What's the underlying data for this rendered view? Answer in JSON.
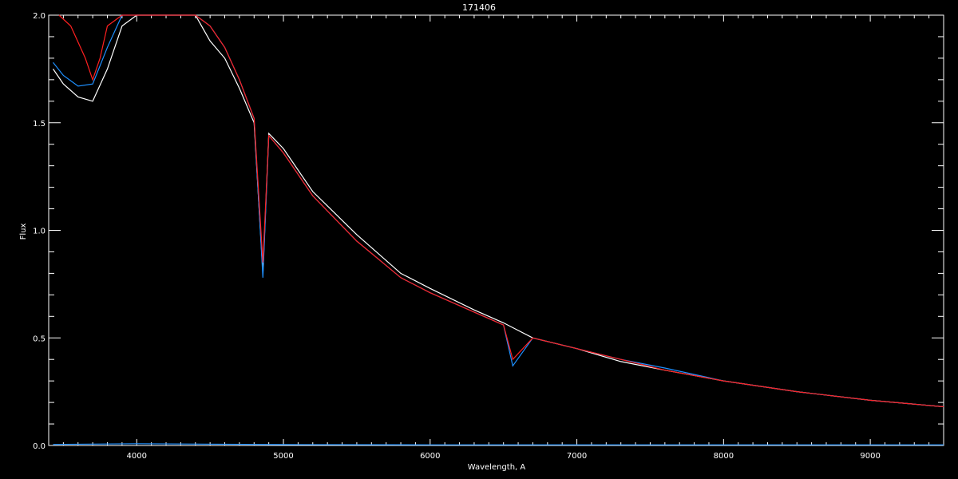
{
  "chart_data": {
    "type": "line",
    "title": "171406",
    "xlabel": "Wavelength, A",
    "ylabel": "Flux",
    "xlim": [
      3400,
      9500
    ],
    "ylim": [
      0.0,
      2.0
    ],
    "grid": false,
    "x_ticks": [
      4000,
      5000,
      6000,
      7000,
      8000,
      9000
    ],
    "x_tick_labels": [
      "4000",
      "5000",
      "6000",
      "7000",
      "8000",
      "9000"
    ],
    "y_ticks": [
      0.0,
      0.5,
      1.0,
      1.5,
      2.0
    ],
    "y_tick_labels": [
      "0.0",
      "0.5",
      "1.0",
      "1.5",
      "2.0"
    ],
    "series": [
      {
        "color": "#ffffff",
        "x": [
          3430,
          3500,
          3600,
          3700,
          3800,
          3900,
          4000,
          4200,
          4400,
          4500,
          4600,
          4700,
          4800,
          4860,
          4900,
          5000,
          5200,
          5500,
          5800,
          6000,
          6300,
          6500,
          6700,
          7000,
          7300,
          7600,
          8000,
          8500,
          9000,
          9500
        ],
        "y": [
          1.75,
          1.68,
          1.62,
          1.6,
          1.75,
          1.95,
          2.05,
          2.1,
          2.05,
          1.88,
          1.8,
          1.66,
          1.5,
          0.8,
          1.45,
          1.38,
          1.18,
          0.98,
          0.8,
          0.73,
          0.63,
          0.57,
          0.5,
          0.45,
          0.39,
          0.35,
          0.3,
          0.25,
          0.21,
          0.18
        ]
      },
      {
        "color": "#1e90ff",
        "x": [
          3430,
          3500,
          3600,
          3700,
          3800,
          3900,
          4000,
          4200,
          4400,
          4500,
          4600,
          4700,
          4800,
          4860,
          4900,
          5000,
          5200,
          5500,
          5800,
          6000,
          6300,
          6500,
          6563,
          6700,
          7000,
          7300,
          7600,
          8000,
          8500,
          9000,
          9500
        ],
        "y": [
          1.78,
          1.72,
          1.67,
          1.68,
          1.85,
          2.05,
          2.1,
          2.12,
          2.1,
          1.95,
          1.85,
          1.7,
          1.52,
          0.78,
          1.44,
          1.36,
          1.16,
          0.95,
          0.78,
          0.71,
          0.62,
          0.56,
          0.37,
          0.5,
          0.45,
          0.4,
          0.36,
          0.3,
          0.25,
          0.21,
          0.18
        ]
      },
      {
        "color": "#ff2020",
        "x": [
          3470,
          3550,
          3650,
          3700,
          3750,
          3800,
          3900,
          4000,
          4200,
          4400,
          4500,
          4600,
          4700,
          4800,
          4860,
          4900,
          5000,
          5200,
          5500,
          5800,
          6000,
          6300,
          6500,
          6563,
          6700,
          7000,
          7300,
          7600,
          8000,
          8500,
          9000,
          9500
        ],
        "y": [
          2.05,
          1.95,
          1.8,
          1.7,
          1.8,
          1.95,
          2.05,
          2.1,
          2.12,
          2.1,
          1.95,
          1.85,
          1.7,
          1.52,
          0.85,
          1.44,
          1.36,
          1.16,
          0.95,
          0.78,
          0.71,
          0.62,
          0.56,
          0.4,
          0.5,
          0.45,
          0.4,
          0.35,
          0.3,
          0.25,
          0.21,
          0.18
        ]
      },
      {
        "color": "#1e90ff",
        "x": [
          3430,
          4000,
          5000,
          6000,
          7000,
          8000,
          9000,
          9500
        ],
        "y": [
          0.005,
          0.008,
          0.004,
          0.003,
          0.003,
          0.003,
          0.003,
          0.003
        ]
      }
    ]
  }
}
